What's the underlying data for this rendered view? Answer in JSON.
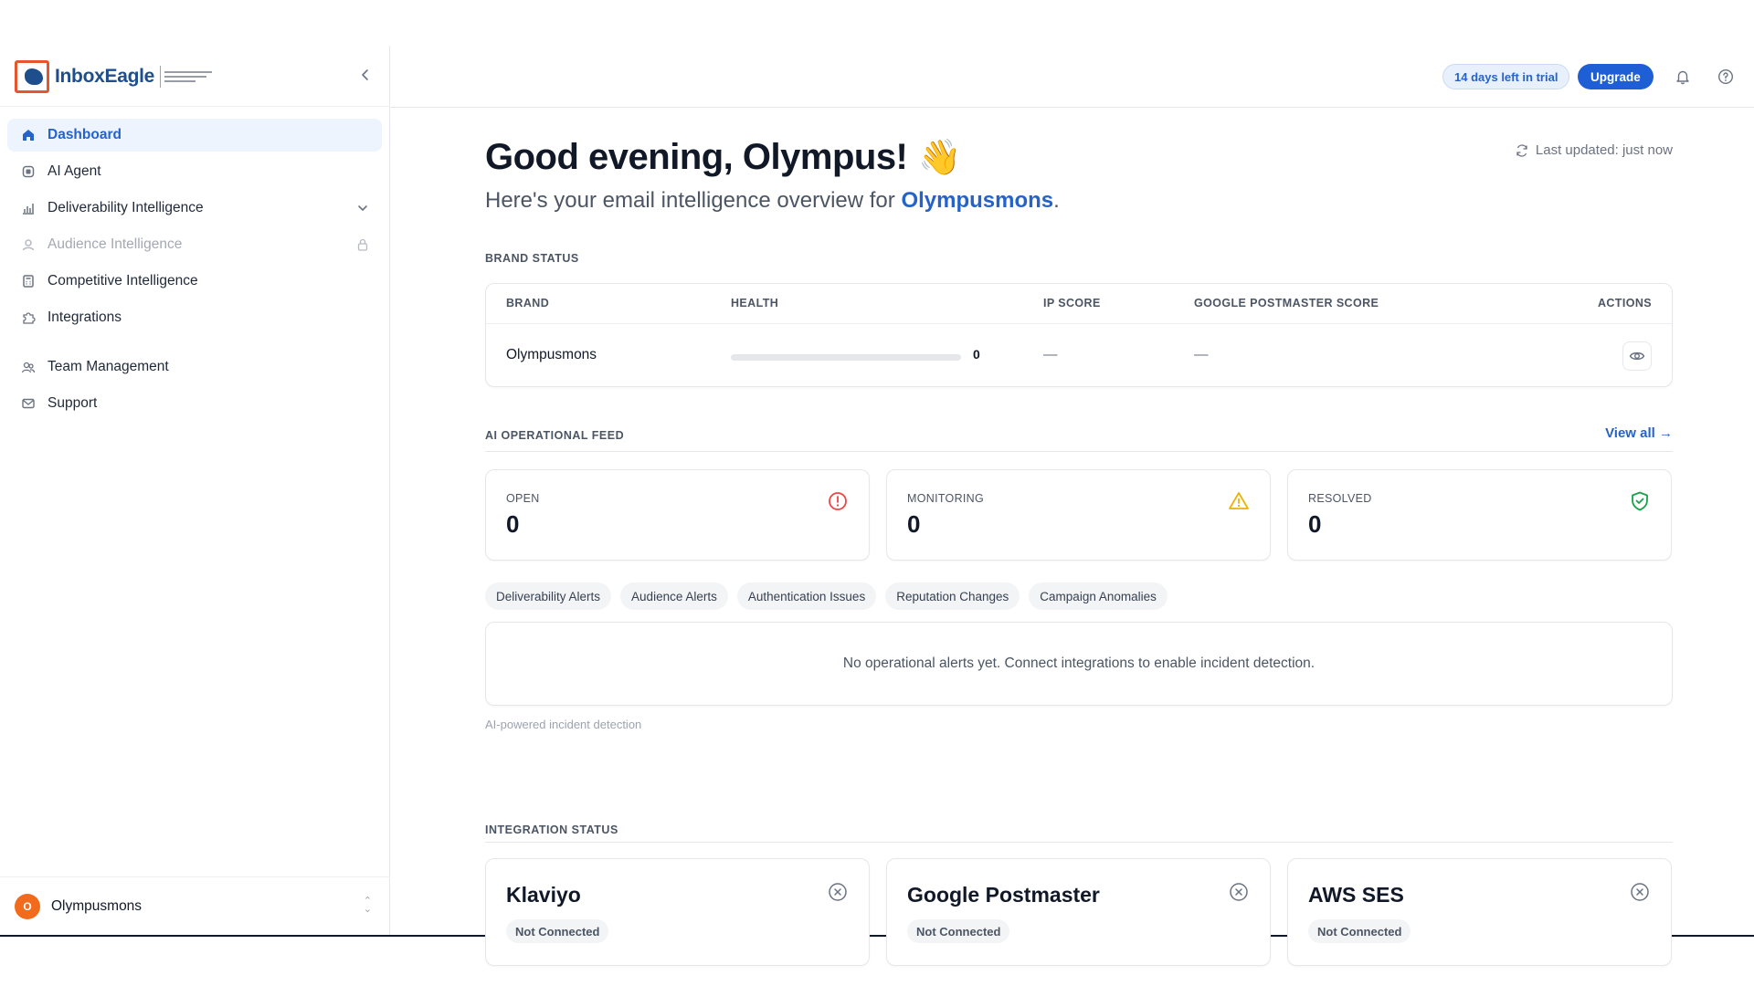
{
  "brand": {
    "name": "InboxEagle"
  },
  "sidebar": {
    "items": [
      {
        "label": "Dashboard",
        "icon": "home-icon",
        "active": true
      },
      {
        "label": "AI Agent",
        "icon": "bot-icon"
      },
      {
        "label": "Deliverability Intelligence",
        "icon": "bar-chart-icon",
        "trail": "chevron-down-icon"
      },
      {
        "label": "Audience Intelligence",
        "icon": "users-icon",
        "trail": "lock-icon",
        "disabled": true
      },
      {
        "label": "Competitive Intelligence",
        "icon": "calculator-icon"
      },
      {
        "label": "Integrations",
        "icon": "puzzle-icon"
      },
      {
        "label": "Team Management",
        "icon": "team-icon"
      },
      {
        "label": "Support",
        "icon": "mail-icon"
      }
    ],
    "workspace": {
      "initial": "O",
      "name": "Olympusmons"
    }
  },
  "topbar": {
    "trial": "14 days left in trial",
    "upgrade": "Upgrade"
  },
  "main": {
    "greeting": "Good evening, Olympus!",
    "wave": "👋",
    "subtitle_prefix": "Here's your email intelligence overview for ",
    "subtitle_brand": "Olympusmons",
    "subtitle_suffix": ".",
    "last_updated": "Last updated: just now",
    "brand_status": {
      "label": "BRAND STATUS",
      "headers": {
        "brand": "BRAND",
        "health": "HEALTH",
        "ip": "IP SCORE",
        "google": "GOOGLE POSTMASTER SCORE",
        "actions": "ACTIONS"
      },
      "row": {
        "brand": "Olympusmons",
        "health_value": "0",
        "health_fraction": 0,
        "ip": "—",
        "google": "—"
      }
    },
    "feed": {
      "label": "AI OPERATIONAL FEED",
      "view_all": "View all →",
      "stats": [
        {
          "label": "OPEN",
          "value": "0",
          "icon": "alert-circle-icon",
          "color": "#ef4444"
        },
        {
          "label": "MONITORING",
          "value": "0",
          "icon": "warning-triangle-icon",
          "color": "#eab308"
        },
        {
          "label": "RESOLVED",
          "value": "0",
          "icon": "shield-check-icon",
          "color": "#16a34a"
        }
      ],
      "filters": [
        "Deliverability Alerts",
        "Audience Alerts",
        "Authentication Issues",
        "Reputation Changes",
        "Campaign Anomalies"
      ],
      "empty": "No operational alerts yet. Connect integrations to enable incident detection.",
      "caption": "AI-powered incident detection"
    },
    "integrations": {
      "label": "INTEGRATION STATUS",
      "items": [
        {
          "name": "Klaviyo",
          "status": "Not Connected"
        },
        {
          "name": "Google Postmaster",
          "status": "Not Connected"
        },
        {
          "name": "AWS SES",
          "status": "Not Connected"
        }
      ]
    }
  }
}
